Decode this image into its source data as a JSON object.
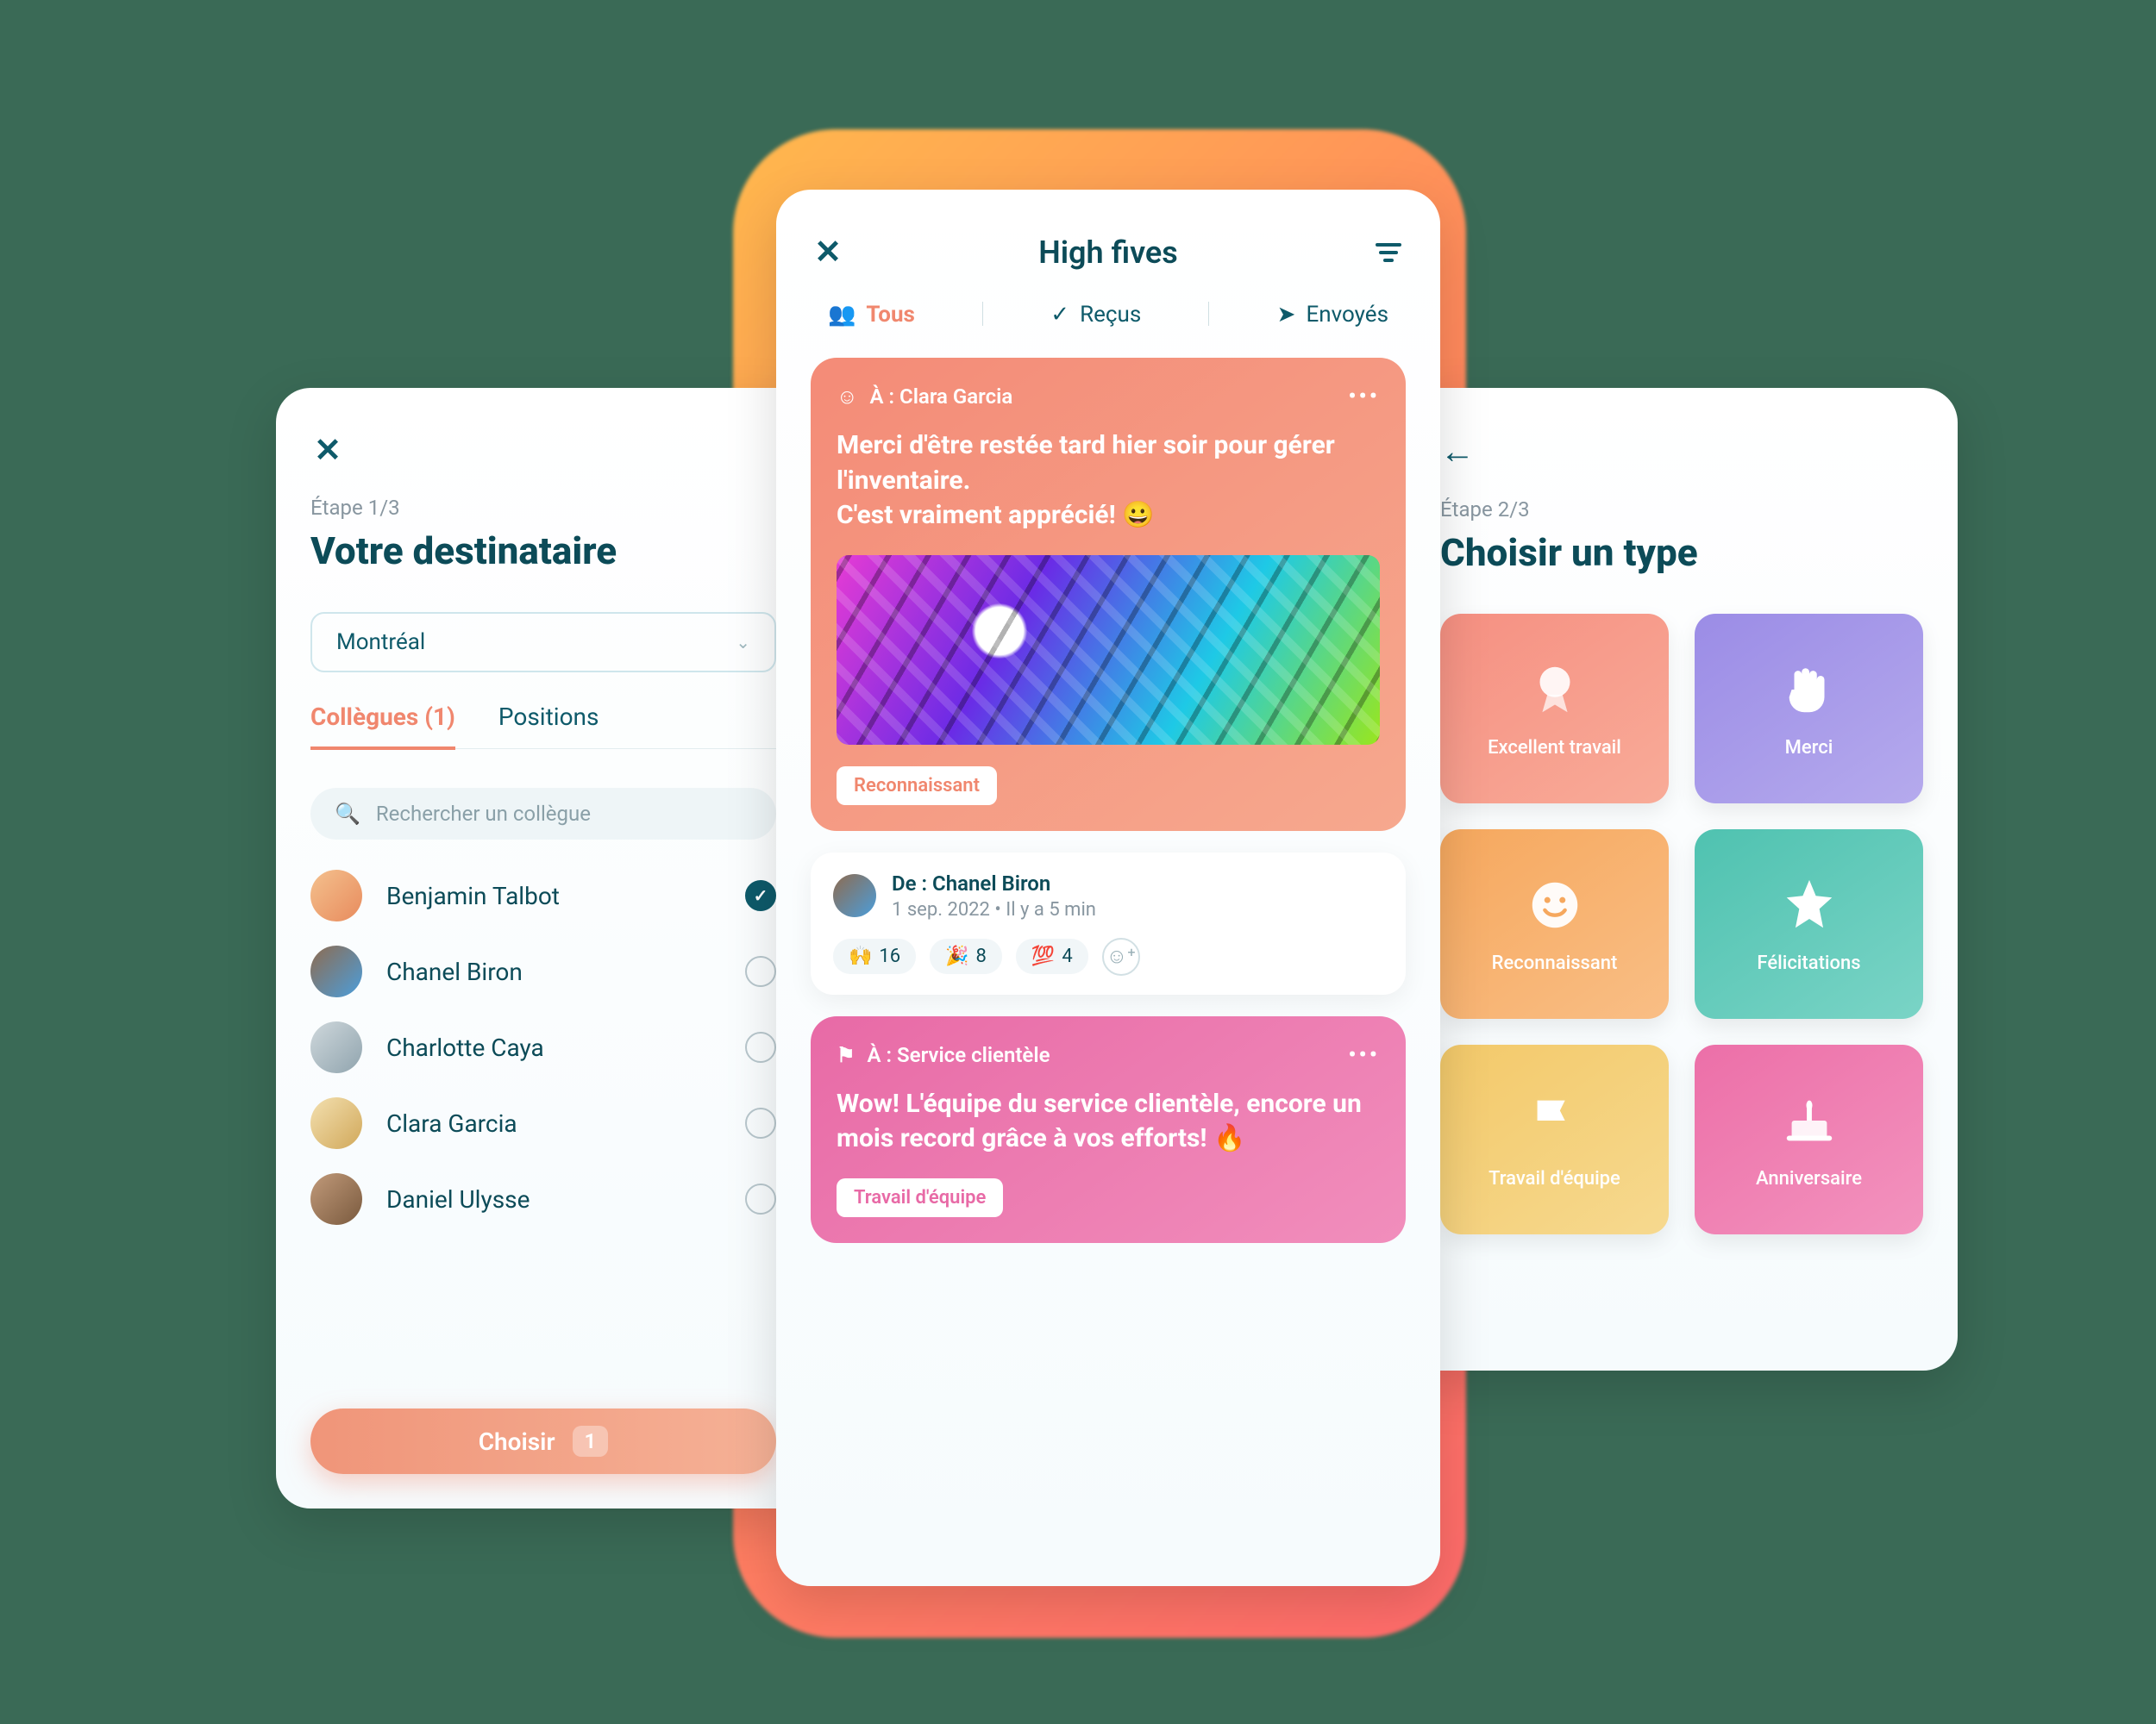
{
  "left": {
    "step": "Étape 1/3",
    "title": "Votre destinataire",
    "location": "Montréal",
    "tabs": {
      "colleagues": "Collègues (1)",
      "positions": "Positions"
    },
    "searchPlaceholder": "Rechercher un collègue",
    "people": [
      {
        "name": "Benjamin Talbot",
        "selected": true
      },
      {
        "name": "Chanel Biron",
        "selected": false
      },
      {
        "name": "Charlotte Caya",
        "selected": false
      },
      {
        "name": "Clara Garcia",
        "selected": false
      },
      {
        "name": "Daniel Ulysse",
        "selected": false
      }
    ],
    "chooseLabel": "Choisir",
    "chooseCount": "1"
  },
  "center": {
    "title": "High fives",
    "segments": {
      "all": "Tous",
      "received": "Reçus",
      "sent": "Envoyés"
    },
    "card1": {
      "to": "À : Clara Garcia",
      "message": "Merci d'être restée tard hier soir pour gérer l'inventaire.\nC'est vraiment apprécié! 😀",
      "tag": "Reconnaissant",
      "fromName": "De : Chanel Biron",
      "fromMeta": "1 sep. 2022  • Il y a 5 min",
      "reactions": [
        {
          "emoji": "🙌",
          "count": "16"
        },
        {
          "emoji": "🎉",
          "count": "8"
        },
        {
          "emoji": "💯",
          "count": "4"
        }
      ]
    },
    "card2": {
      "to": "À : Service clientèle",
      "message": "Wow! L'équipe du service clientèle, encore un mois record grâce à vos efforts! 🔥",
      "tag": "Travail d'équipe"
    }
  },
  "right": {
    "step": "Étape 2/3",
    "title": "Choisir un type",
    "types": [
      "Excellent travail",
      "Merci",
      "Reconnaissant",
      "Félicitations",
      "Travail d'équipe",
      "Anniversaire"
    ]
  }
}
